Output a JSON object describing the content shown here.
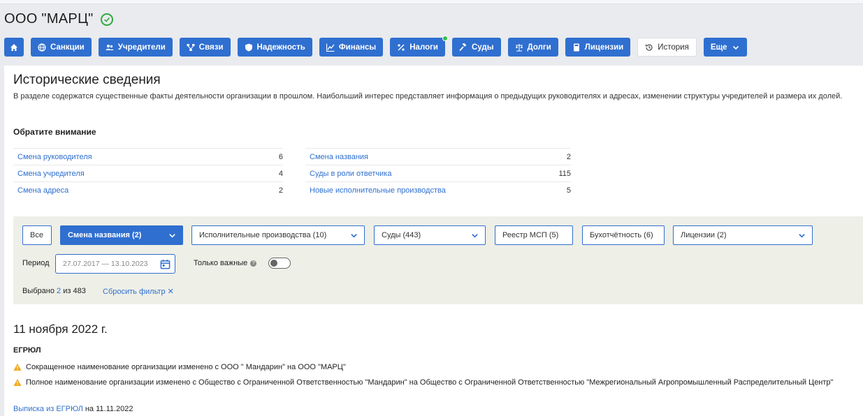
{
  "company": {
    "name": "ООО \"МАРЦ\""
  },
  "nav": {
    "sanctions": "Санкции",
    "founders": "Учредители",
    "links": "Связи",
    "reliability": "Надежность",
    "finance": "Финансы",
    "taxes": "Налоги",
    "courts": "Суды",
    "debts": "Долги",
    "licenses": "Лицензии",
    "history": "История",
    "more": "Еще"
  },
  "section": {
    "title": "Исторические сведения",
    "description": "В разделе содержатся существенные факты деятельности организации в прошлом. Наибольший интерес представляет информация о предыдущих руководителях и адресах, изменении структуры учредителей и размера их долей.",
    "attention": "Обратите внимание"
  },
  "stats_left": [
    {
      "label": "Смена руководителя",
      "count": "6"
    },
    {
      "label": "Смена учредителя",
      "count": "4"
    },
    {
      "label": "Смена адреса",
      "count": "2"
    }
  ],
  "stats_right": [
    {
      "label": "Смена названия",
      "count": "2"
    },
    {
      "label": "Суды в роли ответчика",
      "count": "115"
    },
    {
      "label": "Новые исполнительные производства",
      "count": "5"
    }
  ],
  "filters": {
    "all": "Все",
    "name_change": "Смена названия (2)",
    "exec": "Исполнительные производства (10)",
    "courts": "Суды (443)",
    "msp": "Реестр МСП (5)",
    "accounting": "Бухотчётность (6)",
    "licenses": "Лицензии (2)",
    "period_label": "Период",
    "period_value": "27.07.2017 — 13.10.2023",
    "important_label": "Только важные",
    "selected_prefix": "Выбрано",
    "selected_count": "2",
    "selected_suffix": "из 483",
    "reset": "Сбросить фильтр"
  },
  "entry": {
    "date": "11 ноября 2022 г.",
    "source": "ЕГРЮЛ",
    "events": [
      "Сокращенное наименование организации изменено с ООО \" Мандарин\" на ООО \"МАРЦ\"",
      "Полное наименование организации изменено с Общество с Ограниченной Ответственностью \"Мандарин\" на Общество с Ограниченной Ответственностью \"Межрегиональный Агропромышленный Распределительный Центр\""
    ],
    "extract_link": "Выписка из ЕГРЮЛ",
    "extract_date": "на 11.11.2022"
  },
  "colors": {
    "accent": "#2f6fd0",
    "success": "#2eaa3e",
    "warning": "#f0a91c",
    "filter_bg": "#eeefe7"
  }
}
